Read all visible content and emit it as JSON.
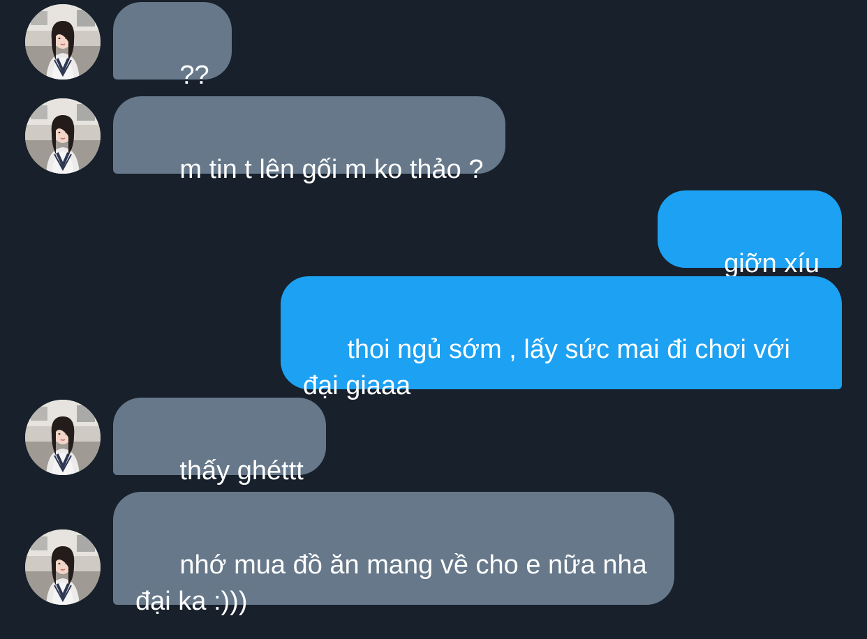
{
  "conversation": {
    "messages": [
      {
        "sender": "contact",
        "text": "??"
      },
      {
        "sender": "contact",
        "text": "m tin t lên gối m ko thảo ?"
      },
      {
        "sender": "me",
        "text": "giỡn xíu"
      },
      {
        "sender": "me",
        "text": "thoi ngủ sớm , lấy sức mai đi chơi với đại giaaa"
      },
      {
        "sender": "contact",
        "text": "thấy ghéttt"
      },
      {
        "sender": "contact",
        "text": "nhớ mua đồ ăn mang về cho e nữa nha đại ka :)))"
      }
    ]
  },
  "colors": {
    "background": "#17202b",
    "incoming_bubble": "#66788a",
    "outgoing_bubble": "#1da1f2",
    "text": "#ffffff"
  },
  "icons": {
    "contact_avatar": "contact-avatar-photo"
  }
}
